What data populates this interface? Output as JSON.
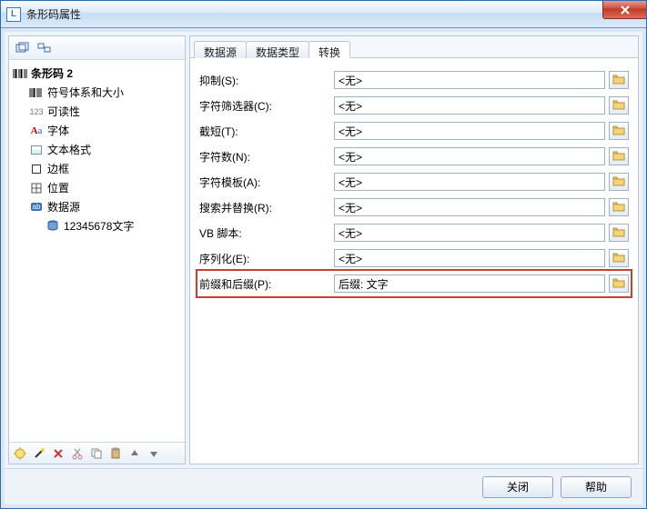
{
  "window": {
    "title": "条形码属性"
  },
  "tree": {
    "root": "条形码 2",
    "items": [
      {
        "label": "符号体系和大小"
      },
      {
        "label": "可读性"
      },
      {
        "label": "字体"
      },
      {
        "label": "文本格式"
      },
      {
        "label": "边框"
      },
      {
        "label": "位置"
      },
      {
        "label": "数据源"
      }
    ],
    "datasource_child": "12345678文字"
  },
  "tabs": {
    "items": [
      {
        "label": "数据源"
      },
      {
        "label": "数据类型"
      },
      {
        "label": "转换"
      }
    ],
    "active": 2
  },
  "form": {
    "rows": [
      {
        "label": "抑制(S):",
        "value": "<无>"
      },
      {
        "label": "字符筛选器(C):",
        "value": "<无>"
      },
      {
        "label": "截短(T):",
        "value": "<无>"
      },
      {
        "label": "字符数(N):",
        "value": "<无>"
      },
      {
        "label": "字符模板(A):",
        "value": "<无>"
      },
      {
        "label": "搜索并替换(R):",
        "value": "<无>"
      },
      {
        "label": "VB 脚本:",
        "value": "<无>"
      },
      {
        "label": "序列化(E):",
        "value": "<无>"
      },
      {
        "label": "前缀和后缀(P):",
        "value": "后缀: 文字",
        "highlight": true
      }
    ]
  },
  "buttons": {
    "close": "关闭",
    "help": "帮助"
  }
}
